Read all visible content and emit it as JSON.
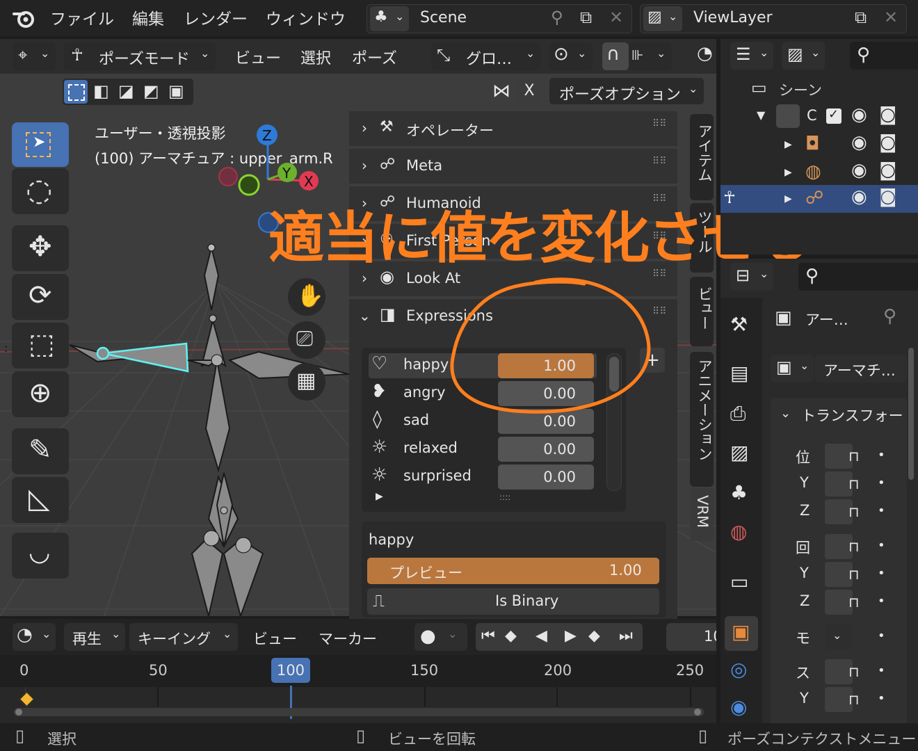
{
  "topbar": {
    "menus": [
      "ファイル",
      "編集",
      "レンダー",
      "ウィンドウ"
    ],
    "scene": "Scene",
    "view_layer": "ViewLayer"
  },
  "viewport_header": {
    "mode": "ポーズモード",
    "menus": [
      "ビュー",
      "選択",
      "ポーズ"
    ],
    "transform": "グロ…",
    "x_toggle": "X",
    "pose_options": "ポーズオプション"
  },
  "viewport": {
    "view_label": "ユーザー・透視投影",
    "object_label": "(100) アーマチュア : upper_arm.R",
    "gizmo": {
      "z": "Z",
      "y": "Y",
      "x": "X"
    }
  },
  "npanel": {
    "sections": [
      "オペレーター",
      "Meta",
      "Humanoid",
      "First Person",
      "Look At",
      "Expressions"
    ],
    "tabs": [
      "アイテム",
      "ツール",
      "ビュー",
      "アニメーション",
      "VRM"
    ],
    "expressions": [
      {
        "name": "happy",
        "value": "1.00",
        "icon": "heart-outline-icon"
      },
      {
        "name": "angry",
        "value": "0.00",
        "icon": "heart-broken-icon"
      },
      {
        "name": "sad",
        "value": "0.00",
        "icon": "drop-icon"
      },
      {
        "name": "relaxed",
        "value": "0.00",
        "icon": "sun-icon"
      },
      {
        "name": "surprised",
        "value": "0.00",
        "icon": "sun-icon"
      }
    ],
    "selected_expression": "happy",
    "preview_label": "プレビュー",
    "preview_value": "1.00",
    "is_binary_label": "Is Binary"
  },
  "annotation": {
    "text": "適当に値を変化させる",
    "color": "#ff7f1e"
  },
  "outliner": {
    "scene_label": "シーン",
    "collection_label": "C"
  },
  "properties": {
    "object_name": "アー…",
    "data_name": "アーマチ…",
    "transform_label": "トランスフォー",
    "rows": [
      "位",
      "Y",
      "Z",
      "回",
      "Y",
      "Z",
      "モ",
      "ス",
      "Y"
    ]
  },
  "timeline": {
    "menus": [
      "再生",
      "キーイング",
      "ビュー",
      "マーカー"
    ],
    "current_frame": "100",
    "frame_field": "10",
    "ticks": [
      "0",
      "50",
      "100",
      "150",
      "200",
      "250"
    ]
  },
  "statusbar": {
    "select": "選択",
    "rotate_view": "ビューを回転",
    "context_menu": "ポーズコンテクストメニュー"
  },
  "colors": {
    "accent_orange": "#b9773e",
    "selection_blue": "#4772b3",
    "timeline_cursor": "#4772b3"
  }
}
